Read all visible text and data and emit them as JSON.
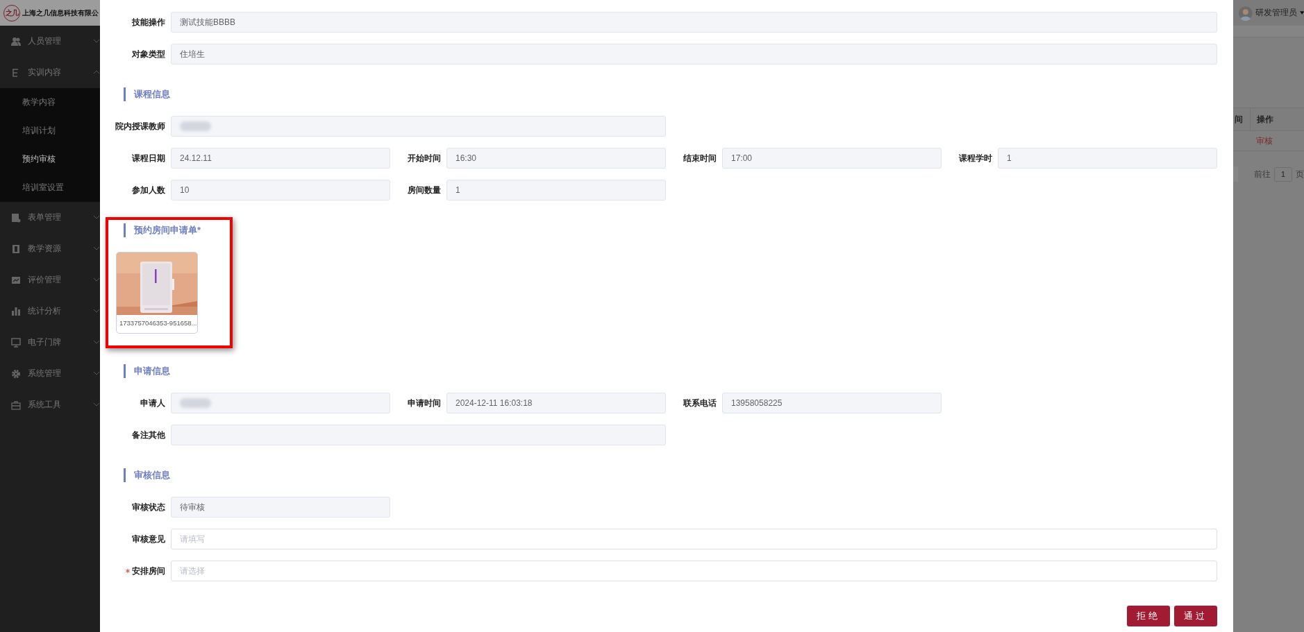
{
  "sidebar": {
    "logo_text": "之几",
    "company": "上海之几信息科技有限公",
    "items": [
      {
        "label": "人员管理",
        "expanded": false
      },
      {
        "label": "实训内容",
        "expanded": true,
        "children": [
          {
            "label": "教学内容",
            "selected": false
          },
          {
            "label": "培训计划",
            "selected": false
          },
          {
            "label": "预约审核",
            "selected": true
          },
          {
            "label": "培训室设置",
            "selected": false
          }
        ]
      },
      {
        "label": "表单管理",
        "expanded": false
      },
      {
        "label": "教学资源",
        "expanded": false
      },
      {
        "label": "评价管理",
        "expanded": false
      },
      {
        "label": "统计分析",
        "expanded": false
      },
      {
        "label": "电子门牌",
        "expanded": false
      },
      {
        "label": "系统管理",
        "expanded": false
      },
      {
        "label": "系统工具",
        "expanded": false
      }
    ]
  },
  "background_page": {
    "user": "研发管理员",
    "table_columns": [
      "间",
      "操作"
    ],
    "row_action": "审核",
    "pagination_label": "前往",
    "page": "1",
    "page_suffix": "页"
  },
  "drawer": {
    "blocks": [
      {
        "kind": "rows",
        "rows": [
          [
            {
              "kind": "readonly",
              "label": "技能操作",
              "value": "测试技能BBBB"
            }
          ],
          [
            {
              "kind": "readonly",
              "label": "对象类型",
              "value": "住培生"
            }
          ]
        ]
      },
      {
        "kind": "title",
        "text": "课程信息"
      },
      {
        "kind": "rows",
        "rows": [
          [
            {
              "kind": "readonly",
              "label": "院内授课教师",
              "redacted": true
            }
          ],
          [
            {
              "kind": "readonly",
              "label": "课程日期",
              "value": "24.12.11"
            },
            {
              "kind": "readonly",
              "label": "开始时间",
              "value": "16:30"
            },
            {
              "kind": "readonly",
              "label": "结束时间",
              "value": "17:00"
            },
            {
              "kind": "readonly",
              "label": "课程学时",
              "value": "1"
            }
          ],
          [
            {
              "kind": "readonly",
              "label": "参加人数",
              "value": "10"
            },
            {
              "kind": "readonly",
              "label": "房间数量",
              "value": "1"
            }
          ]
        ]
      },
      {
        "kind": "title",
        "text": "预约房间申请单*"
      },
      {
        "kind": "attachment",
        "filename": "1733757046353-951658..."
      },
      {
        "kind": "title",
        "text": "申请信息"
      },
      {
        "kind": "rows",
        "rows": [
          [
            {
              "kind": "readonly",
              "label": "申请人",
              "redacted": true
            },
            {
              "kind": "readonly",
              "label": "申请时间",
              "value": "2024-12-11 16:03:18"
            },
            {
              "kind": "readonly",
              "label": "联系电话",
              "value": "13958058225"
            }
          ],
          [
            {
              "kind": "readonly",
              "label": "备注其他"
            }
          ]
        ]
      },
      {
        "kind": "title",
        "text": "审核信息"
      },
      {
        "kind": "rows",
        "rows": [
          [
            {
              "kind": "readonly",
              "label": "审核状态",
              "value": "待审核"
            }
          ],
          [
            {
              "kind": "input",
              "label": "审核意见",
              "placeholder": "请填写"
            }
          ],
          [
            {
              "kind": "input",
              "label": "安排房间",
              "placeholder": "请选择",
              "required": true
            }
          ]
        ]
      }
    ],
    "buttons": [
      {
        "label": "拒绝"
      },
      {
        "label": "通过"
      }
    ]
  }
}
